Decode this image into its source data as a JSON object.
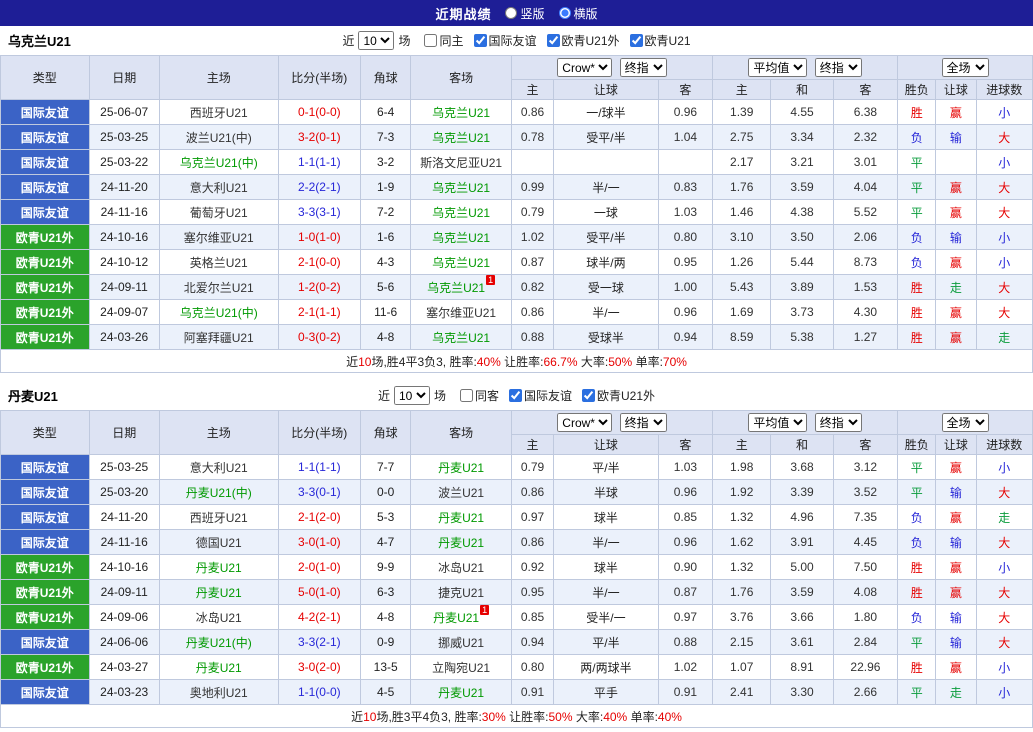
{
  "topbar": {
    "title": "近期战绩",
    "radios": [
      {
        "label": "竖版",
        "selected": false
      },
      {
        "label": "横版",
        "selected": true
      }
    ]
  },
  "colors": {
    "topbar_bg": "#1e1e96",
    "friendly_type_bg": "#3b63c6",
    "euro_type_bg": "#2ba32b",
    "header_bg": "#dde3f3",
    "alt_row_bg": "#ebf1fb",
    "win_red": "#e60000",
    "draw_green": "#0a9c3c",
    "loss_blue": "#2626d8",
    "focal_team_green": "#009900"
  },
  "tables": [
    {
      "team": "乌克兰U21",
      "filter": {
        "prefix": "近",
        "select_value": "10",
        "suffix": "场",
        "checkboxes": [
          {
            "label": "同主",
            "checked": false
          },
          {
            "label": "国际友谊",
            "checked": true
          },
          {
            "label": "欧青U21外",
            "checked": true
          },
          {
            "label": "欧青U21",
            "checked": true
          }
        ]
      },
      "header": {
        "left": [
          "类型",
          "日期",
          "主场",
          "比分(半场)",
          "角球",
          "客场"
        ],
        "g1": {
          "sel1": "Crow*",
          "sel2": "终指",
          "cols": [
            "主",
            "让球",
            "客"
          ]
        },
        "g2": {
          "sel1": "平均值",
          "sel2": "终指",
          "cols": [
            "主",
            "和",
            "客"
          ]
        },
        "g3": {
          "sel": "全场",
          "cols": [
            "胜负",
            "让球",
            "进球数"
          ]
        }
      },
      "rows": [
        {
          "type": "国际友谊",
          "type_class": "friendly",
          "date": "25-06-07",
          "home": "西班牙U21",
          "home_green": false,
          "home_sup": "",
          "score": "0-1(0-0)",
          "score_color": "red",
          "corner": "6-4",
          "away": "乌克兰U21",
          "away_green": true,
          "away_sup": "",
          "odds_home": "0.86",
          "handicap": "一/球半",
          "odds_away": "0.96",
          "avg_home": "1.39",
          "avg_draw": "4.55",
          "avg_away": "6.38",
          "result": "胜",
          "result_color": "red",
          "handicap_res": "赢",
          "handicap_res_color": "red",
          "goals": "小",
          "goals_color": "blue"
        },
        {
          "type": "国际友谊",
          "type_class": "friendly",
          "date": "25-03-25",
          "home": "波兰U21(中)",
          "home_green": false,
          "home_sup": "",
          "score": "3-2(0-1)",
          "score_color": "red",
          "corner": "7-3",
          "away": "乌克兰U21",
          "away_green": true,
          "away_sup": "",
          "odds_home": "0.78",
          "handicap": "受平/半",
          "odds_away": "1.04",
          "avg_home": "2.75",
          "avg_draw": "3.34",
          "avg_away": "2.32",
          "result": "负",
          "result_color": "blue",
          "handicap_res": "输",
          "handicap_res_color": "blue",
          "goals": "大",
          "goals_color": "red"
        },
        {
          "type": "国际友谊",
          "type_class": "friendly",
          "date": "25-03-22",
          "home": "乌克兰U21(中)",
          "home_green": true,
          "home_sup": "",
          "score": "1-1(1-1)",
          "score_color": "blue",
          "corner": "3-2",
          "away": "斯洛文尼亚U21",
          "away_green": false,
          "away_sup": "",
          "odds_home": "",
          "handicap": "",
          "odds_away": "",
          "avg_home": "2.17",
          "avg_draw": "3.21",
          "avg_away": "3.01",
          "result": "平",
          "result_color": "green",
          "handicap_res": "",
          "handicap_res_color": "none",
          "goals": "小",
          "goals_color": "blue"
        },
        {
          "type": "国际友谊",
          "type_class": "friendly",
          "date": "24-11-20",
          "home": "意大利U21",
          "home_green": false,
          "home_sup": "",
          "score": "2-2(2-1)",
          "score_color": "blue",
          "corner": "1-9",
          "away": "乌克兰U21",
          "away_green": true,
          "away_sup": "",
          "odds_home": "0.99",
          "handicap": "半/一",
          "odds_away": "0.83",
          "avg_home": "1.76",
          "avg_draw": "3.59",
          "avg_away": "4.04",
          "result": "平",
          "result_color": "green",
          "handicap_res": "赢",
          "handicap_res_color": "red",
          "goals": "大",
          "goals_color": "red"
        },
        {
          "type": "国际友谊",
          "type_class": "friendly",
          "date": "24-11-16",
          "home": "葡萄牙U21",
          "home_green": false,
          "home_sup": "",
          "score": "3-3(3-1)",
          "score_color": "blue",
          "corner": "7-2",
          "away": "乌克兰U21",
          "away_green": true,
          "away_sup": "",
          "odds_home": "0.79",
          "handicap": "一球",
          "odds_away": "1.03",
          "avg_home": "1.46",
          "avg_draw": "4.38",
          "avg_away": "5.52",
          "result": "平",
          "result_color": "green",
          "handicap_res": "赢",
          "handicap_res_color": "red",
          "goals": "大",
          "goals_color": "red"
        },
        {
          "type": "欧青U21外",
          "type_class": "euro",
          "date": "24-10-16",
          "home": "塞尔维亚U21",
          "home_green": false,
          "home_sup": "",
          "score": "1-0(1-0)",
          "score_color": "red",
          "corner": "1-6",
          "away": "乌克兰U21",
          "away_green": true,
          "away_sup": "",
          "odds_home": "1.02",
          "handicap": "受平/半",
          "odds_away": "0.80",
          "avg_home": "3.10",
          "avg_draw": "3.50",
          "avg_away": "2.06",
          "result": "负",
          "result_color": "blue",
          "handicap_res": "输",
          "handicap_res_color": "blue",
          "goals": "小",
          "goals_color": "blue"
        },
        {
          "type": "欧青U21外",
          "type_class": "euro",
          "date": "24-10-12",
          "home": "英格兰U21",
          "home_green": false,
          "home_sup": "",
          "score": "2-1(0-0)",
          "score_color": "red",
          "corner": "4-3",
          "away": "乌克兰U21",
          "away_green": true,
          "away_sup": "",
          "odds_home": "0.87",
          "handicap": "球半/两",
          "odds_away": "0.95",
          "avg_home": "1.26",
          "avg_draw": "5.44",
          "avg_away": "8.73",
          "result": "负",
          "result_color": "blue",
          "handicap_res": "赢",
          "handicap_res_color": "red",
          "goals": "小",
          "goals_color": "blue"
        },
        {
          "type": "欧青U21外",
          "type_class": "euro",
          "date": "24-09-11",
          "home": "北爱尔兰U21",
          "home_green": false,
          "home_sup": "",
          "score": "1-2(0-2)",
          "score_color": "red",
          "corner": "5-6",
          "away": "乌克兰U21",
          "away_green": true,
          "away_sup": "1",
          "odds_home": "0.82",
          "handicap": "受一球",
          "odds_away": "1.00",
          "avg_home": "5.43",
          "avg_draw": "3.89",
          "avg_away": "1.53",
          "result": "胜",
          "result_color": "red",
          "handicap_res": "走",
          "handicap_res_color": "green",
          "goals": "大",
          "goals_color": "red"
        },
        {
          "type": "欧青U21外",
          "type_class": "euro",
          "date": "24-09-07",
          "home": "乌克兰U21(中)",
          "home_green": true,
          "home_sup": "",
          "score": "2-1(1-1)",
          "score_color": "red",
          "corner": "11-6",
          "away": "塞尔维亚U21",
          "away_green": false,
          "away_sup": "",
          "odds_home": "0.86",
          "handicap": "半/一",
          "odds_away": "0.96",
          "avg_home": "1.69",
          "avg_draw": "3.73",
          "avg_away": "4.30",
          "result": "胜",
          "result_color": "red",
          "handicap_res": "赢",
          "handicap_res_color": "red",
          "goals": "大",
          "goals_color": "red"
        },
        {
          "type": "欧青U21外",
          "type_class": "euro",
          "date": "24-03-26",
          "home": "阿塞拜疆U21",
          "home_green": false,
          "home_sup": "",
          "score": "0-3(0-2)",
          "score_color": "red",
          "corner": "4-8",
          "away": "乌克兰U21",
          "away_green": true,
          "away_sup": "",
          "odds_home": "0.88",
          "handicap": "受球半",
          "odds_away": "0.94",
          "avg_home": "8.59",
          "avg_draw": "5.38",
          "avg_away": "1.27",
          "result": "胜",
          "result_color": "red",
          "handicap_res": "赢",
          "handicap_res_color": "red",
          "goals": "走",
          "goals_color": "green"
        }
      ],
      "summary": [
        {
          "text": "近",
          "red": false
        },
        {
          "text": "10",
          "red": true
        },
        {
          "text": "场,胜4平3负3, 胜率:",
          "red": false
        },
        {
          "text": "40%",
          "red": true
        },
        {
          "text": " 让胜率:",
          "red": false
        },
        {
          "text": "66.7%",
          "red": true
        },
        {
          "text": " 大率:",
          "red": false
        },
        {
          "text": "50%",
          "red": true
        },
        {
          "text": " 单率:",
          "red": false
        },
        {
          "text": "70%",
          "red": true
        }
      ]
    },
    {
      "team": "丹麦U21",
      "filter": {
        "prefix": "近",
        "select_value": "10",
        "suffix": "场",
        "checkboxes": [
          {
            "label": "同客",
            "checked": false
          },
          {
            "label": "国际友谊",
            "checked": true
          },
          {
            "label": "欧青U21外",
            "checked": true
          }
        ]
      },
      "header": {
        "left": [
          "类型",
          "日期",
          "主场",
          "比分(半场)",
          "角球",
          "客场"
        ],
        "g1": {
          "sel1": "Crow*",
          "sel2": "终指",
          "cols": [
            "主",
            "让球",
            "客"
          ]
        },
        "g2": {
          "sel1": "平均值",
          "sel2": "终指",
          "cols": [
            "主",
            "和",
            "客"
          ]
        },
        "g3": {
          "sel": "全场",
          "cols": [
            "胜负",
            "让球",
            "进球数"
          ]
        }
      },
      "rows": [
        {
          "type": "国际友谊",
          "type_class": "friendly",
          "date": "25-03-25",
          "home": "意大利U21",
          "home_green": false,
          "home_sup": "",
          "score": "1-1(1-1)",
          "score_color": "blue",
          "corner": "7-7",
          "away": "丹麦U21",
          "away_green": true,
          "away_sup": "",
          "odds_home": "0.79",
          "handicap": "平/半",
          "odds_away": "1.03",
          "avg_home": "1.98",
          "avg_draw": "3.68",
          "avg_away": "3.12",
          "result": "平",
          "result_color": "green",
          "handicap_res": "赢",
          "handicap_res_color": "red",
          "goals": "小",
          "goals_color": "blue"
        },
        {
          "type": "国际友谊",
          "type_class": "friendly",
          "date": "25-03-20",
          "home": "丹麦U21(中)",
          "home_green": true,
          "home_sup": "",
          "score": "3-3(0-1)",
          "score_color": "blue",
          "corner": "0-0",
          "away": "波兰U21",
          "away_green": false,
          "away_sup": "",
          "odds_home": "0.86",
          "handicap": "半球",
          "odds_away": "0.96",
          "avg_home": "1.92",
          "avg_draw": "3.39",
          "avg_away": "3.52",
          "result": "平",
          "result_color": "green",
          "handicap_res": "输",
          "handicap_res_color": "blue",
          "goals": "大",
          "goals_color": "red"
        },
        {
          "type": "国际友谊",
          "type_class": "friendly",
          "date": "24-11-20",
          "home": "西班牙U21",
          "home_green": false,
          "home_sup": "",
          "score": "2-1(2-0)",
          "score_color": "red",
          "corner": "5-3",
          "away": "丹麦U21",
          "away_green": true,
          "away_sup": "",
          "odds_home": "0.97",
          "handicap": "球半",
          "odds_away": "0.85",
          "avg_home": "1.32",
          "avg_draw": "4.96",
          "avg_away": "7.35",
          "result": "负",
          "result_color": "blue",
          "handicap_res": "赢",
          "handicap_res_color": "red",
          "goals": "走",
          "goals_color": "green"
        },
        {
          "type": "国际友谊",
          "type_class": "friendly",
          "date": "24-11-16",
          "home": "德国U21",
          "home_green": false,
          "home_sup": "",
          "score": "3-0(1-0)",
          "score_color": "red",
          "corner": "4-7",
          "away": "丹麦U21",
          "away_green": true,
          "away_sup": "",
          "odds_home": "0.86",
          "handicap": "半/一",
          "odds_away": "0.96",
          "avg_home": "1.62",
          "avg_draw": "3.91",
          "avg_away": "4.45",
          "result": "负",
          "result_color": "blue",
          "handicap_res": "输",
          "handicap_res_color": "blue",
          "goals": "大",
          "goals_color": "red"
        },
        {
          "type": "欧青U21外",
          "type_class": "euro",
          "date": "24-10-16",
          "home": "丹麦U21",
          "home_green": true,
          "home_sup": "",
          "score": "2-0(1-0)",
          "score_color": "red",
          "corner": "9-9",
          "away": "冰岛U21",
          "away_green": false,
          "away_sup": "",
          "odds_home": "0.92",
          "handicap": "球半",
          "odds_away": "0.90",
          "avg_home": "1.32",
          "avg_draw": "5.00",
          "avg_away": "7.50",
          "result": "胜",
          "result_color": "red",
          "handicap_res": "赢",
          "handicap_res_color": "red",
          "goals": "小",
          "goals_color": "blue"
        },
        {
          "type": "欧青U21外",
          "type_class": "euro",
          "date": "24-09-11",
          "home": "丹麦U21",
          "home_green": true,
          "home_sup": "",
          "score": "5-0(1-0)",
          "score_color": "red",
          "corner": "6-3",
          "away": "捷克U21",
          "away_green": false,
          "away_sup": "",
          "odds_home": "0.95",
          "handicap": "半/一",
          "odds_away": "0.87",
          "avg_home": "1.76",
          "avg_draw": "3.59",
          "avg_away": "4.08",
          "result": "胜",
          "result_color": "red",
          "handicap_res": "赢",
          "handicap_res_color": "red",
          "goals": "大",
          "goals_color": "red"
        },
        {
          "type": "欧青U21外",
          "type_class": "euro",
          "date": "24-09-06",
          "home": "冰岛U21",
          "home_green": false,
          "home_sup": "",
          "score": "4-2(2-1)",
          "score_color": "red",
          "corner": "4-8",
          "away": "丹麦U21",
          "away_green": true,
          "away_sup": "1",
          "odds_home": "0.85",
          "handicap": "受半/一",
          "odds_away": "0.97",
          "avg_home": "3.76",
          "avg_draw": "3.66",
          "avg_away": "1.80",
          "result": "负",
          "result_color": "blue",
          "handicap_res": "输",
          "handicap_res_color": "blue",
          "goals": "大",
          "goals_color": "red"
        },
        {
          "type": "国际友谊",
          "type_class": "friendly",
          "date": "24-06-06",
          "home": "丹麦U21(中)",
          "home_green": true,
          "home_sup": "",
          "score": "3-3(2-1)",
          "score_color": "blue",
          "corner": "0-9",
          "away": "挪威U21",
          "away_green": false,
          "away_sup": "",
          "odds_home": "0.94",
          "handicap": "平/半",
          "odds_away": "0.88",
          "avg_home": "2.15",
          "avg_draw": "3.61",
          "avg_away": "2.84",
          "result": "平",
          "result_color": "green",
          "handicap_res": "输",
          "handicap_res_color": "blue",
          "goals": "大",
          "goals_color": "red"
        },
        {
          "type": "欧青U21外",
          "type_class": "euro",
          "date": "24-03-27",
          "home": "丹麦U21",
          "home_green": true,
          "home_sup": "",
          "score": "3-0(2-0)",
          "score_color": "red",
          "corner": "13-5",
          "away": "立陶宛U21",
          "away_green": false,
          "away_sup": "",
          "odds_home": "0.80",
          "handicap": "两/两球半",
          "odds_away": "1.02",
          "avg_home": "1.07",
          "avg_draw": "8.91",
          "avg_away": "22.96",
          "result": "胜",
          "result_color": "red",
          "handicap_res": "赢",
          "handicap_res_color": "red",
          "goals": "小",
          "goals_color": "blue"
        },
        {
          "type": "国际友谊",
          "type_class": "friendly",
          "date": "24-03-23",
          "home": "奥地利U21",
          "home_green": false,
          "home_sup": "",
          "score": "1-1(0-0)",
          "score_color": "blue",
          "corner": "4-5",
          "away": "丹麦U21",
          "away_green": true,
          "away_sup": "",
          "odds_home": "0.91",
          "handicap": "平手",
          "odds_away": "0.91",
          "avg_home": "2.41",
          "avg_draw": "3.30",
          "avg_away": "2.66",
          "result": "平",
          "result_color": "green",
          "handicap_res": "走",
          "handicap_res_color": "green",
          "goals": "小",
          "goals_color": "blue"
        }
      ],
      "summary": [
        {
          "text": "近",
          "red": false
        },
        {
          "text": "10",
          "red": true
        },
        {
          "text": "场,胜3平4负3, 胜率:",
          "red": false
        },
        {
          "text": "30%",
          "red": true
        },
        {
          "text": " 让胜率:",
          "red": false
        },
        {
          "text": "50%",
          "red": true
        },
        {
          "text": " 大率:",
          "red": false
        },
        {
          "text": "40%",
          "red": true
        },
        {
          "text": " 单率:",
          "red": false
        },
        {
          "text": "40%",
          "red": true
        }
      ]
    }
  ]
}
